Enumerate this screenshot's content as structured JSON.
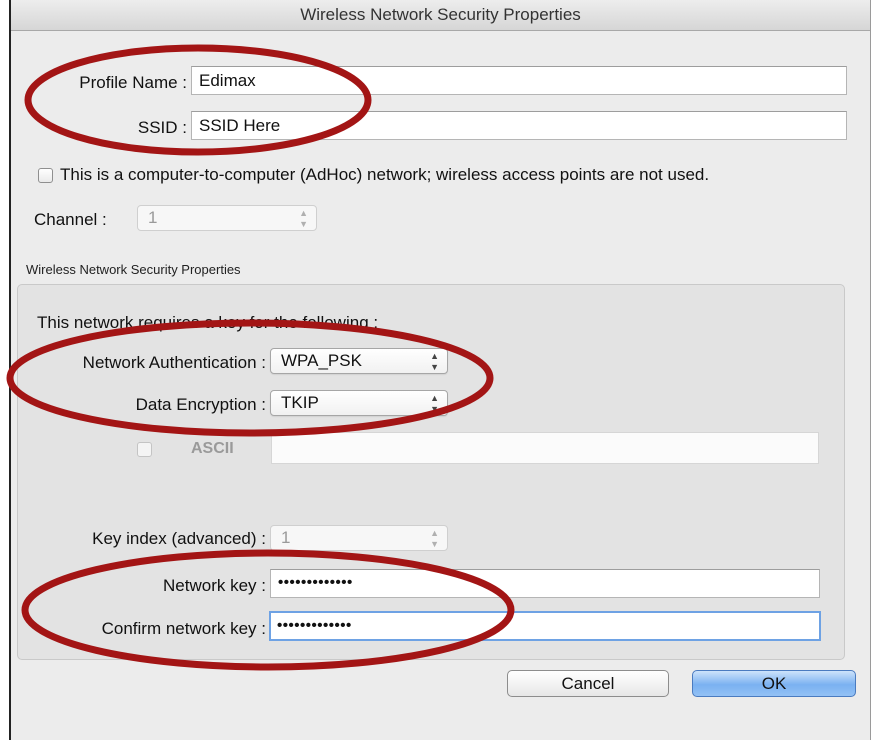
{
  "window": {
    "title": "Wireless Network Security Properties"
  },
  "profile": {
    "profile_name_label": "Profile Name :",
    "profile_name_value": "Edimax",
    "ssid_label": "SSID :",
    "ssid_value": "SSID Here",
    "adhoc_label": "This is a computer-to-computer (AdHoc) network; wireless access points are not used.",
    "adhoc_checked": false,
    "channel_label": "Channel :",
    "channel_value": "1"
  },
  "security": {
    "group_title": "Wireless Network Security Properties",
    "requires_key_text": "This network requires a key for the following :",
    "auth_label": "Network Authentication :",
    "auth_value": "WPA_PSK",
    "encryption_label": "Data Encryption :",
    "encryption_value": "TKIP",
    "ascii_label": "ASCII",
    "ascii_value": "",
    "key_index_label": "Key index (advanced) :",
    "key_index_value": "1",
    "network_key_label": "Network key :",
    "network_key_value": "•••••••••••••",
    "confirm_key_label": "Confirm network key :",
    "confirm_key_value": "•••••••••••••"
  },
  "buttons": {
    "cancel": "Cancel",
    "ok": "OK"
  },
  "colors": {
    "annotation_ellipse": "#a31515",
    "focus_ring": "#6ea2e4",
    "default_button": "#7ab1f1"
  }
}
